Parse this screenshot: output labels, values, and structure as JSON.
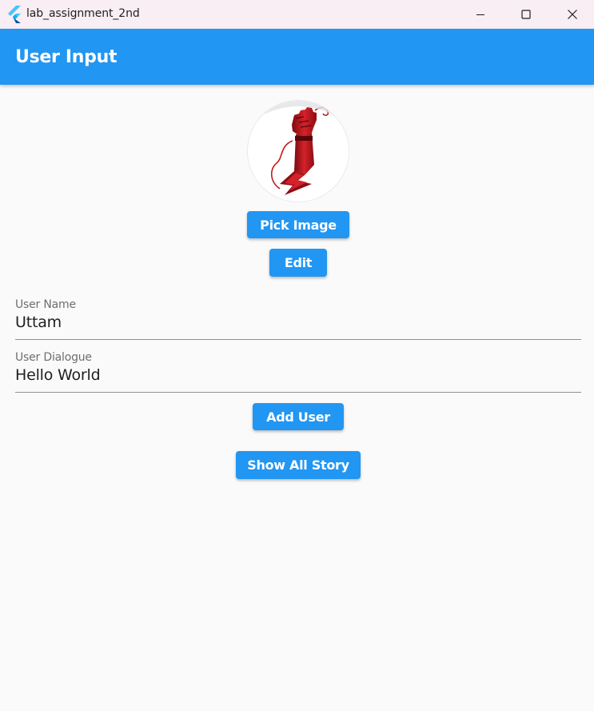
{
  "window": {
    "title": "lab_assignment_2nd",
    "logo_icon": "flutter-logo-icon",
    "controls": [
      "minimize-icon",
      "maximize-icon",
      "close-icon"
    ]
  },
  "appbar": {
    "title": "User Input",
    "color": "#2196f3"
  },
  "avatar": {
    "icon": "raised-fist-lightning-icon",
    "accent": "#c41a1f"
  },
  "buttons": {
    "pick_image": "Pick Image",
    "edit": "Edit",
    "add_user": "Add User",
    "show_all_story": "Show All Story"
  },
  "form": {
    "user_name": {
      "label": "User Name",
      "value": "Uttam"
    },
    "user_dialogue": {
      "label": "User Dialogue",
      "value": "Hello World"
    }
  }
}
